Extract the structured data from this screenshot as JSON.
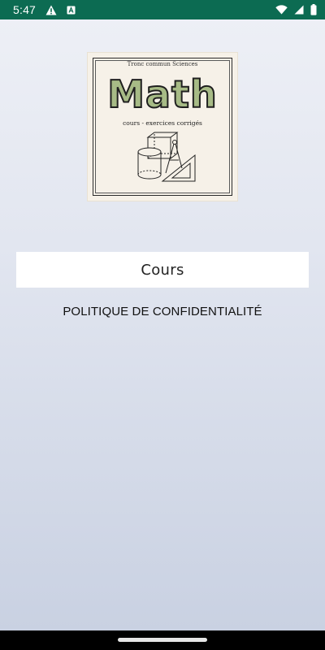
{
  "status_bar": {
    "time": "5:47",
    "icons": [
      "warning-icon",
      "a-notification-icon",
      "wifi-icon",
      "signal-icon",
      "battery-icon"
    ]
  },
  "logo": {
    "subtitle": "Tronc commun Sciences",
    "title": "Math",
    "tagline": "cours  -  exercices corrigés"
  },
  "main": {
    "cours_label": "Cours",
    "privacy_label": "POLITIQUE DE CONFIDENTIALITÉ"
  },
  "colors": {
    "status_bar": "#0c6b52",
    "logo_title": "#a7bb86",
    "background_top": "#eef0f6",
    "background_bottom": "#c9d1e2"
  }
}
